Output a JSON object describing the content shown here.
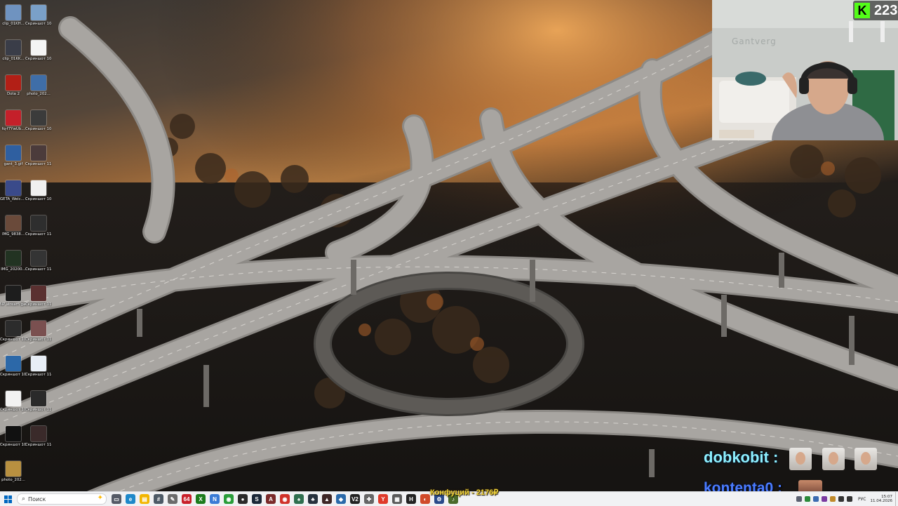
{
  "desktop": {
    "icons": [
      {
        "label": "clip_01KH...",
        "color": "#6f93c0"
      },
      {
        "label": "Скриншот 10-04-20...",
        "color": "#7aa0c8"
      },
      {
        "label": "clip_01KK...",
        "color": "#3a3d48"
      },
      {
        "label": "Скриншот 10-04-20...",
        "color": "#f4f4f4"
      },
      {
        "label": "Dota 2",
        "color": "#b21f16"
      },
      {
        "label": "photo_202...",
        "color": "#3f6ea8"
      },
      {
        "label": "fq-f7YwUb...",
        "color": "#c4202a"
      },
      {
        "label": "Скриншот 10-04-20...",
        "color": "#3b3b3b"
      },
      {
        "label": "gant_3.gif",
        "color": "#2f5fa0"
      },
      {
        "label": "Скриншот 11-04-20...",
        "color": "#4b3b3b"
      },
      {
        "label": "GETA_Welc... 2_generati...",
        "color": "#3a4a8a"
      },
      {
        "label": "Скриншот 10-04-20...",
        "color": "#f0f0f0"
      },
      {
        "label": "IMG_9838...",
        "color": "#6a4a3a"
      },
      {
        "label": "Скриншот 11-04-20...",
        "color": "#2e2e2e"
      },
      {
        "label": "IMG_20200...",
        "color": "#223322"
      },
      {
        "label": "Скриншот 11-04-20...",
        "color": "#343434"
      },
      {
        "label": "NP stream gantver1...",
        "color": "#1d1d1d"
      },
      {
        "label": "Скриншот 11-04-20...",
        "color": "#5a3030"
      },
      {
        "label": "Скриншот 10-04-20...",
        "color": "#2c2c2c"
      },
      {
        "label": "Скриншот 11-04-20...",
        "color": "#7a5050"
      },
      {
        "label": "Скриншот 10-04-20...",
        "color": "#2c68a8"
      },
      {
        "label": "Скриншот 11-04-20...",
        "color": "#e8eef6"
      },
      {
        "label": "Скриншот 10-04-20...",
        "color": "#f2f2f2"
      },
      {
        "label": "Скриншот 11-04-20...",
        "color": "#2a2a2a"
      },
      {
        "label": "Скриншот 10-04-20...",
        "color": "#111111"
      },
      {
        "label": "Скриншот 11-04-20...",
        "color": "#3a2a2a"
      },
      {
        "label": "photo_202...",
        "color": "#b89040"
      }
    ]
  },
  "webcam": {
    "watermark": "Gantverg"
  },
  "stream": {
    "viewer_count": "223",
    "platform_logo": "K",
    "platform_color": "#53fc18"
  },
  "chat": {
    "messages": [
      {
        "user": "dobkobit",
        "separator": ":",
        "emote_count": 3
      },
      {
        "user": "kontenta0",
        "separator": ":",
        "emote_count": 1
      }
    ]
  },
  "donation": {
    "text": "Конфуций - 2176₽"
  },
  "taskbar": {
    "search_placeholder": "Поиск",
    "apps": [
      {
        "name": "task-view",
        "color": "#555a66",
        "glyph": "▭"
      },
      {
        "name": "edge",
        "color": "#1e88c9",
        "glyph": "e"
      },
      {
        "name": "explorer",
        "color": "#f2b600",
        "glyph": "▤"
      },
      {
        "name": "calculator",
        "color": "#4d5a66",
        "glyph": "#"
      },
      {
        "name": "paint",
        "color": "#6b6b6b",
        "glyph": "✎"
      },
      {
        "name": "app-64",
        "color": "#c8202a",
        "glyph": "64"
      },
      {
        "name": "xbox",
        "color": "#1c7c1c",
        "glyph": "X"
      },
      {
        "name": "notepad",
        "color": "#3a7bd5",
        "glyph": "N"
      },
      {
        "name": "chrome",
        "color": "#2a9d3a",
        "glyph": "◉"
      },
      {
        "name": "obs",
        "color": "#2a2a2a",
        "glyph": "●"
      },
      {
        "name": "app-steam",
        "color": "#1b2838",
        "glyph": "S"
      },
      {
        "name": "app-a",
        "color": "#7a2a2a",
        "glyph": "A"
      },
      {
        "name": "chrome-2",
        "color": "#d0322a",
        "glyph": "◉"
      },
      {
        "name": "app-b",
        "color": "#2f6f4f",
        "glyph": "♠"
      },
      {
        "name": "app-c",
        "color": "#26313d",
        "glyph": "♣"
      },
      {
        "name": "app-d",
        "color": "#3d2626",
        "glyph": "▲"
      },
      {
        "name": "app-e",
        "color": "#2a6aaa",
        "glyph": "◆"
      },
      {
        "name": "app-v2",
        "color": "#222222",
        "glyph": "V2"
      },
      {
        "name": "app-f",
        "color": "#666666",
        "glyph": "✚"
      },
      {
        "name": "yandex",
        "color": "#e03a2a",
        "glyph": "Y"
      },
      {
        "name": "app-g",
        "color": "#5a5a5a",
        "glyph": "▦"
      },
      {
        "name": "app-h",
        "color": "#222222",
        "glyph": "H"
      },
      {
        "name": "app-i",
        "color": "#d04a2a",
        "glyph": "◐"
      },
      {
        "name": "app-j",
        "color": "#2a4a8a",
        "glyph": "⚙"
      },
      {
        "name": "app-k",
        "color": "#4a6a2a",
        "glyph": "♪"
      }
    ],
    "language": "РУС",
    "time": "15:07",
    "date": "11.04.2026"
  }
}
